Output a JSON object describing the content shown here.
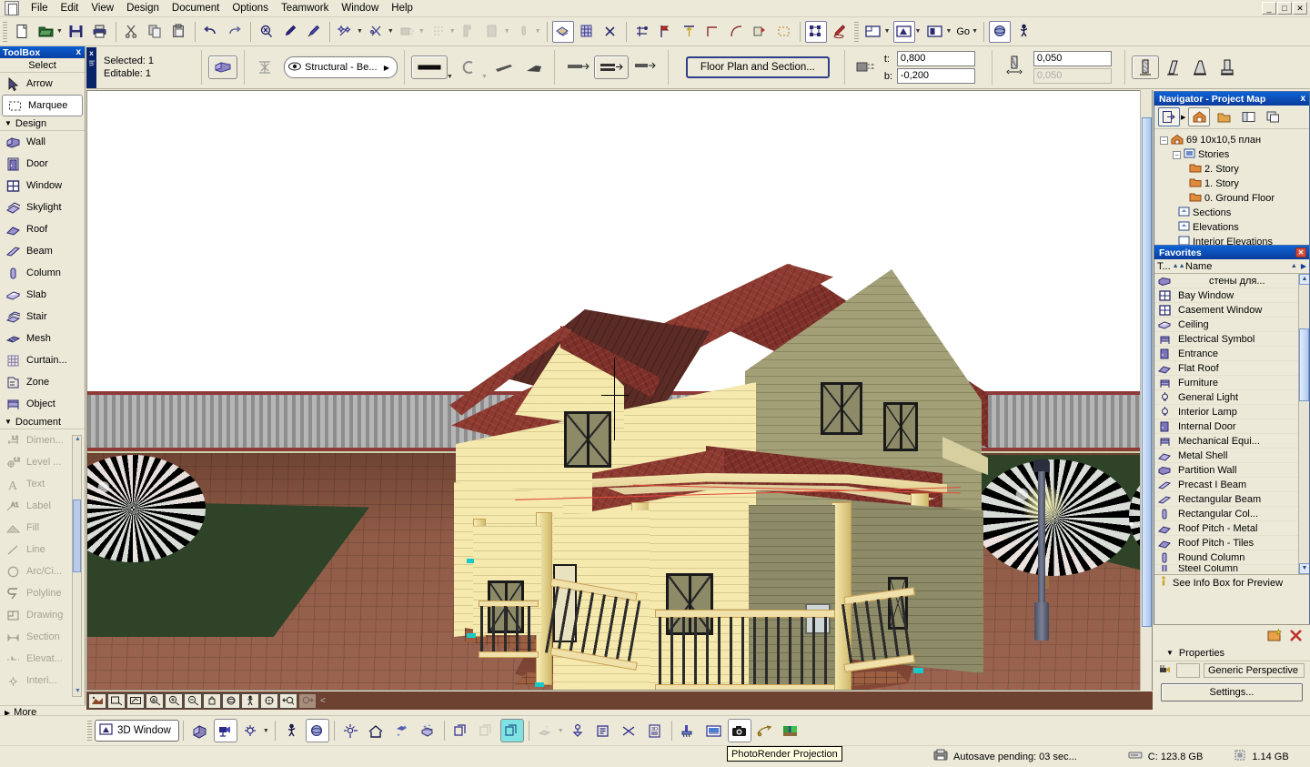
{
  "window": {
    "minimize_label": "_",
    "maximize_label": "□",
    "close_label": "✕"
  },
  "menu": {
    "items": [
      "File",
      "Edit",
      "View",
      "Design",
      "Document",
      "Options",
      "Teamwork",
      "Window",
      "Help"
    ]
  },
  "toolbar": {
    "groups": [
      {
        "buttons": [
          {
            "name": "new-icon",
            "glyph": "📄",
            "state": "normal"
          },
          {
            "name": "open-icon",
            "glyph": "📂",
            "state": "normal",
            "dropdown": true
          },
          {
            "name": "save-icon",
            "glyph": "💾",
            "state": "normal"
          },
          {
            "name": "print-icon",
            "glyph": "🖨",
            "state": "normal"
          }
        ]
      },
      {
        "buttons": [
          {
            "name": "cut-icon",
            "glyph": "✂",
            "state": "normal"
          },
          {
            "name": "copy-icon",
            "glyph": "⧉",
            "state": "normal"
          },
          {
            "name": "paste-icon",
            "glyph": "📋",
            "state": "normal"
          }
        ]
      },
      {
        "buttons": [
          {
            "name": "undo-icon",
            "glyph": "↶",
            "state": "normal"
          },
          {
            "name": "redo-icon",
            "glyph": "↷",
            "state": "normal"
          }
        ]
      },
      {
        "buttons": [
          {
            "name": "find-select-icon",
            "glyph": "⌕",
            "state": "normal"
          },
          {
            "name": "eyedropper-icon",
            "glyph": "✒",
            "state": "normal"
          },
          {
            "name": "syringe-icon",
            "glyph": "💉",
            "state": "normal"
          }
        ]
      },
      {
        "buttons": [
          {
            "name": "magic-wand-icon",
            "glyph": "✨",
            "state": "normal",
            "dropdown": true
          },
          {
            "name": "trim-icon",
            "glyph": "✂",
            "state": "normal",
            "dropdown": true
          },
          {
            "name": "fill-icon",
            "glyph": "▦",
            "state": "disabled",
            "dropdown": true
          },
          {
            "name": "dots-icon",
            "glyph": "⁙",
            "state": "disabled",
            "dropdown": true
          },
          {
            "name": "corner-icon",
            "glyph": "◰",
            "state": "disabled"
          },
          {
            "name": "layer-icon",
            "glyph": "▤",
            "state": "disabled",
            "dropdown": true
          },
          {
            "name": "pin-icon",
            "glyph": "⬤",
            "state": "disabled",
            "dropdown": true
          }
        ]
      },
      {
        "buttons": [
          {
            "name": "solid-element-operations-icon",
            "glyph": "◧",
            "state": "selected"
          },
          {
            "name": "curtain-wall-icon",
            "glyph": "▥",
            "state": "normal"
          },
          {
            "name": "intersect-icon",
            "glyph": "✕",
            "state": "normal"
          }
        ]
      },
      {
        "buttons": [
          {
            "name": "split-icon",
            "glyph": "⌖",
            "state": "normal"
          },
          {
            "name": "drag-icon",
            "glyph": "⚑",
            "state": "normal"
          },
          {
            "name": "elevate-icon",
            "glyph": "⇕",
            "state": "normal"
          },
          {
            "name": "adjust-icon",
            "glyph": "⌐",
            "state": "normal"
          },
          {
            "name": "curve-icon",
            "glyph": "◜",
            "state": "normal"
          },
          {
            "name": "stretch-icon",
            "glyph": "⬓",
            "state": "normal"
          },
          {
            "name": "marquee-icon",
            "glyph": "⬚",
            "state": "normal"
          }
        ]
      },
      {
        "buttons": [
          {
            "name": "group-icon",
            "glyph": "⧈",
            "state": "selected"
          },
          {
            "name": "pencil-icon",
            "glyph": "✏",
            "state": "normal"
          }
        ]
      },
      {
        "buttons": [
          {
            "name": "floor-plan-window-icon",
            "glyph": "▢",
            "state": "normal",
            "dropdown": true
          },
          {
            "name": "3d-window-icon",
            "glyph": "◍",
            "state": "selected",
            "dropdown": true
          },
          {
            "name": "section-window-icon",
            "glyph": "▣",
            "state": "normal",
            "dropdown": true
          }
        ]
      },
      {
        "buttons": [
          {
            "name": "go-label",
            "glyph": "Go",
            "state": "label",
            "dropdown": true
          }
        ]
      },
      {
        "buttons": [
          {
            "name": "orbit-icon",
            "glyph": "◉",
            "state": "selected"
          },
          {
            "name": "walk-icon",
            "glyph": "🚶",
            "state": "normal"
          }
        ]
      }
    ],
    "go_label": "Go"
  },
  "infobox": {
    "handle_label": "In",
    "selected_label": "Selected: 1",
    "editable_label": "Editable: 1",
    "tool_icon": "wall-icon",
    "favorite_icon": "favorites-icon",
    "layer_combo": "Structural - Be...",
    "structure_buttons": [
      {
        "name": "wall-structure-icon"
      },
      {
        "name": "wall-curved-icon"
      },
      {
        "name": "wall-trapezoid-icon"
      },
      {
        "name": "wall-polygon-icon"
      }
    ],
    "geometry_buttons": [
      {
        "name": "wall-straight-geometry-icon"
      },
      {
        "name": "wall-chained-geometry-icon"
      },
      {
        "name": "wall-rect-geometry-icon"
      }
    ],
    "floor_plan_button": "Floor Plan and Section...",
    "top_label": "t:",
    "top_value": "0,800",
    "bottom_label": "b:",
    "bottom_value": "-0,200",
    "thickness_value": "0,050",
    "thickness_value2": "0,050",
    "profile_buttons": [
      {
        "name": "wall-profile-straight-icon",
        "selected": true
      },
      {
        "name": "wall-profile-slanted-icon",
        "selected": false
      },
      {
        "name": "wall-profile-double-slanted-icon",
        "selected": false
      },
      {
        "name": "wall-profile-complex-icon",
        "selected": false
      }
    ]
  },
  "toolbox": {
    "title": "ToolBox",
    "close_label": "x",
    "select_group": "Select",
    "select_items": [
      {
        "label": "Arrow",
        "icon": "arrow-icon",
        "active": false
      },
      {
        "label": "Marquee",
        "icon": "marquee-icon",
        "active": true
      }
    ],
    "design_group": "Design",
    "design_items": [
      {
        "label": "Wall",
        "icon": "wall-icon"
      },
      {
        "label": "Door",
        "icon": "door-icon"
      },
      {
        "label": "Window",
        "icon": "window-icon"
      },
      {
        "label": "Skylight",
        "icon": "skylight-icon"
      },
      {
        "label": "Roof",
        "icon": "roof-icon"
      },
      {
        "label": "Beam",
        "icon": "beam-icon"
      },
      {
        "label": "Column",
        "icon": "column-icon"
      },
      {
        "label": "Slab",
        "icon": "slab-icon"
      },
      {
        "label": "Stair",
        "icon": "stair-icon"
      },
      {
        "label": "Mesh",
        "icon": "mesh-icon"
      },
      {
        "label": "Curtain...",
        "icon": "curtain-wall-icon"
      },
      {
        "label": "Zone",
        "icon": "zone-icon"
      },
      {
        "label": "Object",
        "icon": "object-icon"
      }
    ],
    "document_group": "Document",
    "document_items": [
      {
        "label": "Dimen...",
        "icon": "dimension-icon"
      },
      {
        "label": "Level ...",
        "icon": "level-dimension-icon"
      },
      {
        "label": "Text",
        "icon": "text-icon"
      },
      {
        "label": "Label",
        "icon": "label-icon"
      },
      {
        "label": "Fill",
        "icon": "fill-icon"
      },
      {
        "label": "Line",
        "icon": "line-icon"
      },
      {
        "label": "Arc/Ci...",
        "icon": "arc-circle-icon"
      },
      {
        "label": "Polyline",
        "icon": "polyline-icon"
      },
      {
        "label": "Drawing",
        "icon": "drawing-icon"
      },
      {
        "label": "Section",
        "icon": "section-icon"
      },
      {
        "label": "Elevat...",
        "icon": "elevation-icon"
      },
      {
        "label": "Interi...",
        "icon": "interior-elevation-icon"
      }
    ],
    "more_group": "More"
  },
  "navigator": {
    "title": "Navigator - Project Map",
    "close_label": "x",
    "tools": [
      {
        "name": "navigator-menu-icon",
        "selected": false,
        "dropdown": true
      },
      {
        "name": "project-map-icon",
        "selected": true
      },
      {
        "name": "view-map-icon",
        "selected": false
      },
      {
        "name": "layout-book-icon",
        "selected": false
      },
      {
        "name": "publisher-sets-icon",
        "selected": false
      }
    ],
    "tree": [
      {
        "label": "69 10x10,5 план",
        "depth": 0,
        "expander": "-",
        "icon": "project-icon"
      },
      {
        "label": "Stories",
        "depth": 1,
        "expander": "-",
        "icon": "stories-icon"
      },
      {
        "label": "2. Story",
        "depth": 2,
        "expander": "",
        "icon": "story-icon"
      },
      {
        "label": "1. Story",
        "depth": 2,
        "expander": "",
        "icon": "story-icon"
      },
      {
        "label": "0. Ground Floor",
        "depth": 2,
        "expander": "",
        "icon": "story-icon"
      },
      {
        "label": "Sections",
        "depth": 1,
        "expander": "",
        "icon": "sections-icon"
      },
      {
        "label": "Elevations",
        "depth": 1,
        "expander": "",
        "icon": "elevations-icon"
      },
      {
        "label": "Interior Elevations",
        "depth": 1,
        "expander": "",
        "icon": "interior-elevations-icon"
      }
    ]
  },
  "favorites": {
    "title": "Favorites",
    "close_label": "✕",
    "col_type": "T...",
    "col_name": "Name",
    "sort_glyph": "▲▲",
    "menu_glyph": "▶",
    "items": [
      {
        "name": "стены для...",
        "icon": "wall-icon",
        "russian": true
      },
      {
        "name": "Bay Window",
        "icon": "window-icon"
      },
      {
        "name": "Casement Window",
        "icon": "window-icon"
      },
      {
        "name": "Ceiling",
        "icon": "slab-icon"
      },
      {
        "name": "Electrical Symbol",
        "icon": "object-icon"
      },
      {
        "name": "Entrance",
        "icon": "door-icon"
      },
      {
        "name": "Flat Roof",
        "icon": "roof-icon"
      },
      {
        "name": "Furniture",
        "icon": "object-icon"
      },
      {
        "name": "General Light",
        "icon": "lamp-icon"
      },
      {
        "name": "Interior Lamp",
        "icon": "lamp-icon"
      },
      {
        "name": "Internal Door",
        "icon": "door-icon"
      },
      {
        "name": "Mechanical Equi...",
        "icon": "object-icon"
      },
      {
        "name": "Metal Shell",
        "icon": "roof-icon"
      },
      {
        "name": "Partition Wall",
        "icon": "wall-icon"
      },
      {
        "name": "Precast I Beam",
        "icon": "beam-icon"
      },
      {
        "name": "Rectangular Beam",
        "icon": "beam-icon"
      },
      {
        "name": "Rectangular Col...",
        "icon": "column-icon"
      },
      {
        "name": "Roof Pitch - Metal",
        "icon": "roof-icon"
      },
      {
        "name": "Roof Pitch - Tiles",
        "icon": "roof-icon"
      },
      {
        "name": "Round Column",
        "icon": "column-icon"
      },
      {
        "name": "Steel Column",
        "icon": "column-icon"
      }
    ],
    "footer": "See Info Box for Preview",
    "footer_icon": "info-icon"
  },
  "properties": {
    "new_button_icon": "new-favorite-icon",
    "delete_button_icon": "delete-icon",
    "header": "Properties",
    "expander": "▼",
    "camera_icon": "camera-icon",
    "value": "Generic Perspective",
    "settings_button": "Settings..."
  },
  "viewport": {
    "zoom_buttons": [
      {
        "name": "fit-in-window-icon"
      },
      {
        "name": "zoom-area-icon"
      },
      {
        "name": "previous-zoom-icon"
      },
      {
        "name": "zoom-in-out-icon"
      },
      {
        "name": "zoom-in-icon"
      },
      {
        "name": "zoom-out-icon"
      },
      {
        "name": "pan-icon"
      },
      {
        "name": "orbit-icon"
      },
      {
        "name": "explore-icon"
      },
      {
        "name": "3d-cutaway-icon"
      },
      {
        "name": "previous-view-icon"
      },
      {
        "name": "next-view-icon",
        "disabled": true
      }
    ],
    "prev_arrow": "<"
  },
  "bottom_toolbar": {
    "window_label": "3D Window",
    "window_icon": "3d-window-icon",
    "buttons": [
      {
        "name": "3d-projection-settings-icon",
        "state": "normal"
      },
      {
        "name": "3d-camera-icon",
        "state": "selected"
      },
      {
        "name": "axonometry-icon",
        "state": "normal",
        "dropdown": true
      },
      {
        "name": "walk-icon",
        "state": "normal"
      },
      {
        "name": "orbit-icon",
        "state": "selected"
      },
      {
        "name": "sun-settings-icon",
        "state": "normal"
      },
      {
        "name": "home-view-icon",
        "state": "normal"
      },
      {
        "name": "3d-sun-icon",
        "state": "normal"
      },
      {
        "name": "3d-effects-icon",
        "state": "normal"
      },
      {
        "name": "3d-all-icon",
        "state": "normal"
      },
      {
        "name": "3d-marquee-icon",
        "state": "disabled"
      },
      {
        "name": "3d-selection-icon",
        "state": "highlighted"
      },
      {
        "name": "3d-filter-icon",
        "state": "disabled",
        "dropdown": true
      },
      {
        "name": "3d-cutting-planes-icon",
        "state": "normal"
      },
      {
        "name": "3d-list-icon",
        "state": "normal"
      },
      {
        "name": "3d-crossing-icon",
        "state": "normal"
      },
      {
        "name": "3d-doc-icon",
        "state": "normal"
      },
      {
        "name": "paint-bucket-icon",
        "state": "normal"
      },
      {
        "name": "photorender-settings-icon",
        "state": "normal"
      },
      {
        "name": "photorender-projection-icon",
        "state": "selected"
      },
      {
        "name": "fly-through-icon",
        "state": "normal"
      },
      {
        "name": "render-preview-icon",
        "state": "normal"
      }
    ]
  },
  "tooltip": {
    "text": "PhotoRender Projection"
  },
  "statusbar": {
    "autosave_icon": "autosave-icon",
    "autosave": "Autosave pending: 03 sec...",
    "disk_icon": "disk-icon",
    "disk": "C: 123.8 GB",
    "memory_icon": "memory-icon",
    "memory": "1.14 GB"
  }
}
